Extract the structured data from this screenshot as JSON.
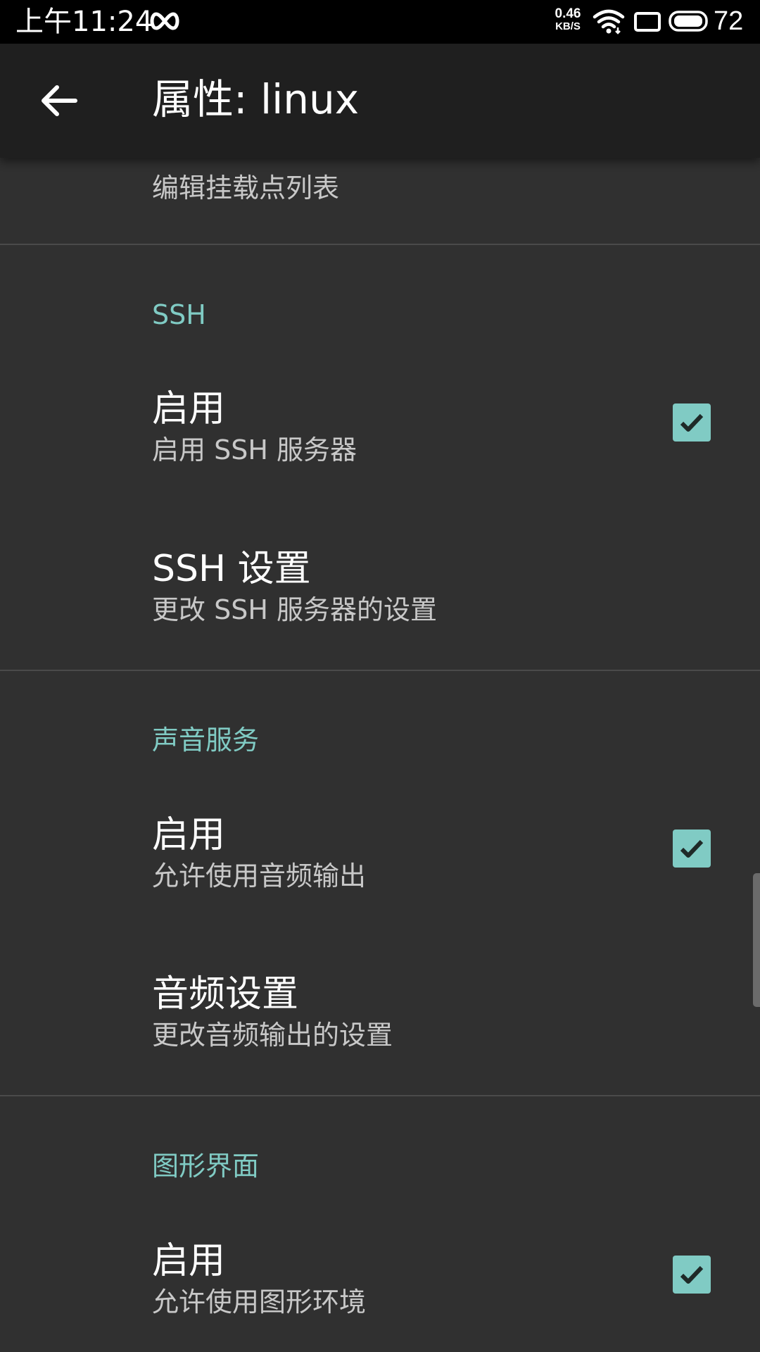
{
  "status_bar": {
    "time": "上午11:24",
    "net_speed_value": "0.46",
    "net_speed_unit": "KB/S",
    "battery": "72",
    "icons": [
      "infinity-icon",
      "wifi-icon",
      "screen-icon",
      "battery-icon"
    ]
  },
  "app_bar": {
    "title": "属性: linux",
    "back_icon": "arrow-back-icon"
  },
  "content": {
    "partial_item_summary": "编辑挂载点列表",
    "sections": [
      {
        "category": "SSH",
        "items": [
          {
            "title": "启用",
            "summary": "启用 SSH 服务器",
            "checked": true
          },
          {
            "title": "SSH 设置",
            "summary": "更改 SSH 服务器的设置"
          }
        ]
      },
      {
        "category": "声音服务",
        "items": [
          {
            "title": "启用",
            "summary": "允许使用音频输出",
            "checked": true
          },
          {
            "title": "音频设置",
            "summary": "更改音频输出的设置"
          }
        ]
      },
      {
        "category": "图形界面",
        "items": [
          {
            "title": "启用",
            "summary": "允许使用图形环境",
            "checked": true
          }
        ]
      }
    ]
  },
  "colors": {
    "background": "#303030",
    "app_bar": "#1f1f1f",
    "status_bar": "#000000",
    "accent": "#80cbc4",
    "text_primary": "#ffffff",
    "text_secondary": "#c8c8c8"
  }
}
